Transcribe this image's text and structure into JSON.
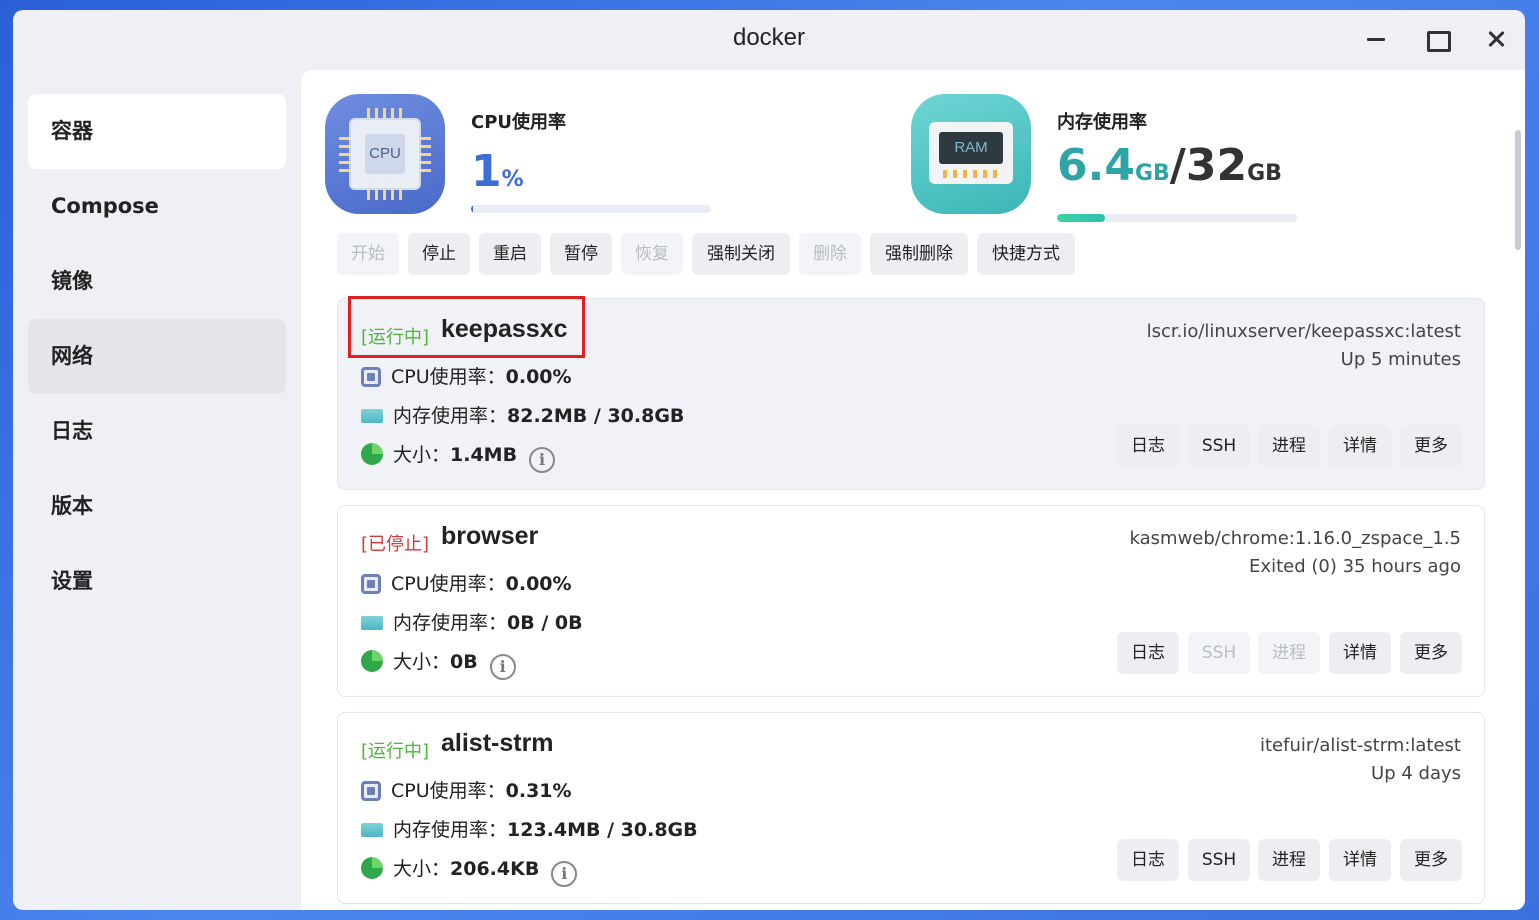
{
  "window": {
    "title": "docker"
  },
  "sidebar": {
    "items": [
      {
        "label": "容器"
      },
      {
        "label": "Compose"
      },
      {
        "label": "镜像"
      },
      {
        "label": "网络"
      },
      {
        "label": "日志"
      },
      {
        "label": "版本"
      },
      {
        "label": "设置"
      }
    ]
  },
  "stats": {
    "cpu": {
      "label": "CPU使用率",
      "value": "1",
      "unit": "%",
      "icon_text": "CPU",
      "usage_fraction": 0.01
    },
    "ram": {
      "label": "内存使用率",
      "used": "6.4",
      "used_unit": "GB",
      "sep": "/",
      "total": "32",
      "total_unit": "GB",
      "icon_text": "RAM",
      "usage_fraction": 0.2
    }
  },
  "toolbar": {
    "buttons": [
      {
        "label": "开始",
        "disabled": true
      },
      {
        "label": "停止",
        "disabled": false
      },
      {
        "label": "重启",
        "disabled": false
      },
      {
        "label": "暂停",
        "disabled": false
      },
      {
        "label": "恢复",
        "disabled": true
      },
      {
        "label": "强制关闭",
        "disabled": false
      },
      {
        "label": "删除",
        "disabled": true
      },
      {
        "label": "强制删除",
        "disabled": false
      },
      {
        "label": "快捷方式",
        "disabled": false
      }
    ]
  },
  "containers": [
    {
      "status": "[运行中]",
      "name": "keepassxc",
      "image": "lscr.io/linuxserver/keepassxc:latest",
      "uptime": "Up 5 minutes",
      "cpu_label": "CPU使用率：",
      "cpu": "0.00%",
      "mem_label": "内存使用率：",
      "mem": "82.2MB / 30.8GB",
      "size_label": "大小：",
      "size": "1.4MB",
      "buttons": [
        "日志",
        "SSH",
        "进程",
        "详情",
        "更多"
      ]
    },
    {
      "status": "[已停止]",
      "name": "browser",
      "image": "kasmweb/chrome:1.16.0_zspace_1.5",
      "uptime": "Exited (0) 35 hours ago",
      "cpu_label": "CPU使用率：",
      "cpu": "0.00%",
      "mem_label": "内存使用率：",
      "mem": "0B / 0B",
      "size_label": "大小：",
      "size": "0B",
      "buttons": [
        "日志",
        "SSH",
        "进程",
        "详情",
        "更多"
      ]
    },
    {
      "status": "[运行中]",
      "name": "alist-strm",
      "image": "itefuir/alist-strm:latest",
      "uptime": "Up 4 days",
      "cpu_label": "CPU使用率：",
      "cpu": "0.31%",
      "mem_label": "内存使用率：",
      "mem": "123.4MB / 30.8GB",
      "size_label": "大小：",
      "size": "206.4KB",
      "buttons": [
        "日志",
        "SSH",
        "进程",
        "详情",
        "更多"
      ]
    }
  ],
  "colors": {
    "running": "#4fb33d",
    "stopped": "#d23b3b",
    "cpu_accent": "#3d6ed6",
    "ram_accent": "#30a3a7",
    "highlight": "#e02020"
  }
}
